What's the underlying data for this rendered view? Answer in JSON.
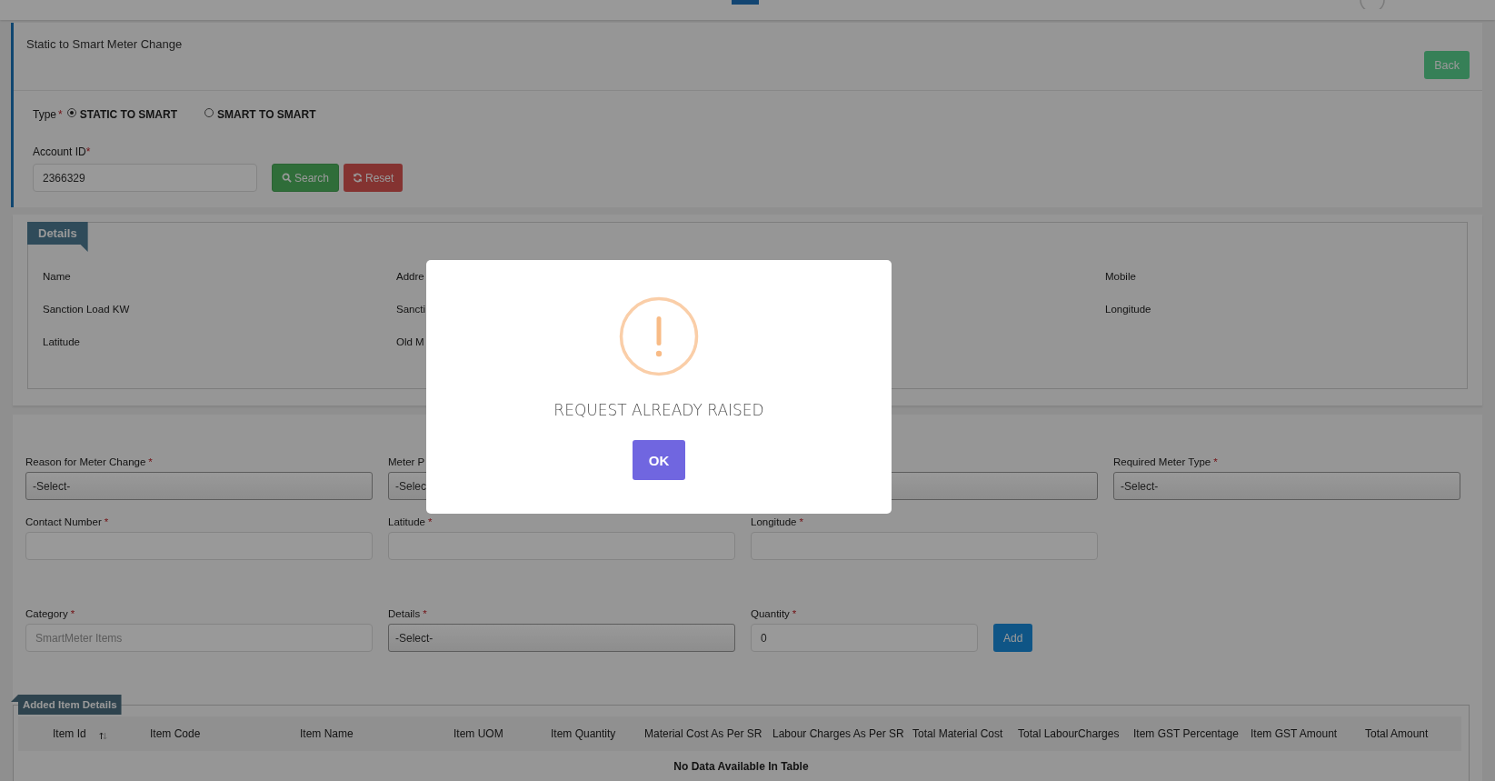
{
  "page_title": "Static to Smart Meter Change",
  "back_button": "Back",
  "type_field": {
    "label": "Type",
    "mark": "*",
    "options": [
      {
        "label": "STATIC TO SMART",
        "selected": true
      },
      {
        "label": "SMART TO SMART",
        "selected": false
      }
    ]
  },
  "account_id": {
    "label": "Account ID",
    "mark": "*",
    "value": "2366329"
  },
  "search_button": "Search",
  "reset_button": "Reset",
  "details": {
    "legend": "Details",
    "rows": [
      [
        "Name",
        "Addre",
        null,
        "Mobile"
      ],
      [
        "Sanction Load KW",
        "Sancti",
        null,
        "Longitude"
      ],
      [
        "Latitude",
        "Old M",
        null,
        null
      ]
    ]
  },
  "form_rows": [
    [
      {
        "kind": "select",
        "label": "Reason for Meter Change",
        "mark": "*",
        "value": "-Select-"
      },
      {
        "kind": "select",
        "label": "Meter P",
        "value": "-Selec"
      },
      {
        "kind": "select"
      },
      {
        "kind": "select",
        "label": "Required Meter Type",
        "mark": "*",
        "value": "-Select-"
      }
    ],
    [
      {
        "kind": "text",
        "label": "Contact Number",
        "mark": "*"
      },
      {
        "kind": "text",
        "label": "Latitude",
        "mark": "*"
      },
      {
        "kind": "text",
        "label": "Longitude",
        "mark": "*"
      },
      null
    ],
    [
      {
        "kind": "text",
        "label": "Category",
        "mark": "*",
        "placeholder": "SmartMeter Items"
      },
      {
        "kind": "select",
        "label": "Details",
        "mark": "*",
        "value": "-Select-"
      },
      {
        "kind": "text",
        "label": "Quantity",
        "mark": "*",
        "value": "0"
      },
      {
        "kind": "button",
        "label": "Add"
      }
    ]
  ],
  "items_table": {
    "legend": "Added Item Details",
    "columns": [
      {
        "label": "Item Id",
        "sortable": true
      },
      {
        "label": "Item Code",
        "sortable": false
      },
      {
        "label": "Item Name",
        "sortable": false
      },
      {
        "label": "Item UOM",
        "sortable": false
      },
      {
        "label": "Item Quantity",
        "sortable": false
      },
      {
        "label": "Material Cost As Per SR",
        "sortable": false
      },
      {
        "label": "Labour Charges As Per SR",
        "sortable": false
      },
      {
        "label": "Total Material Cost",
        "sortable": false
      },
      {
        "label": "Total LabourCharges",
        "sortable": false
      },
      {
        "label": "Item GST Percentage",
        "sortable": false
      },
      {
        "label": "Item GST Amount",
        "sortable": false
      },
      {
        "label": "Total Amount",
        "sortable": false
      }
    ],
    "empty_message": "No Data Available In Table"
  },
  "dialog": {
    "message": "REQUEST ALREADY RAISED",
    "button": "OK"
  }
}
